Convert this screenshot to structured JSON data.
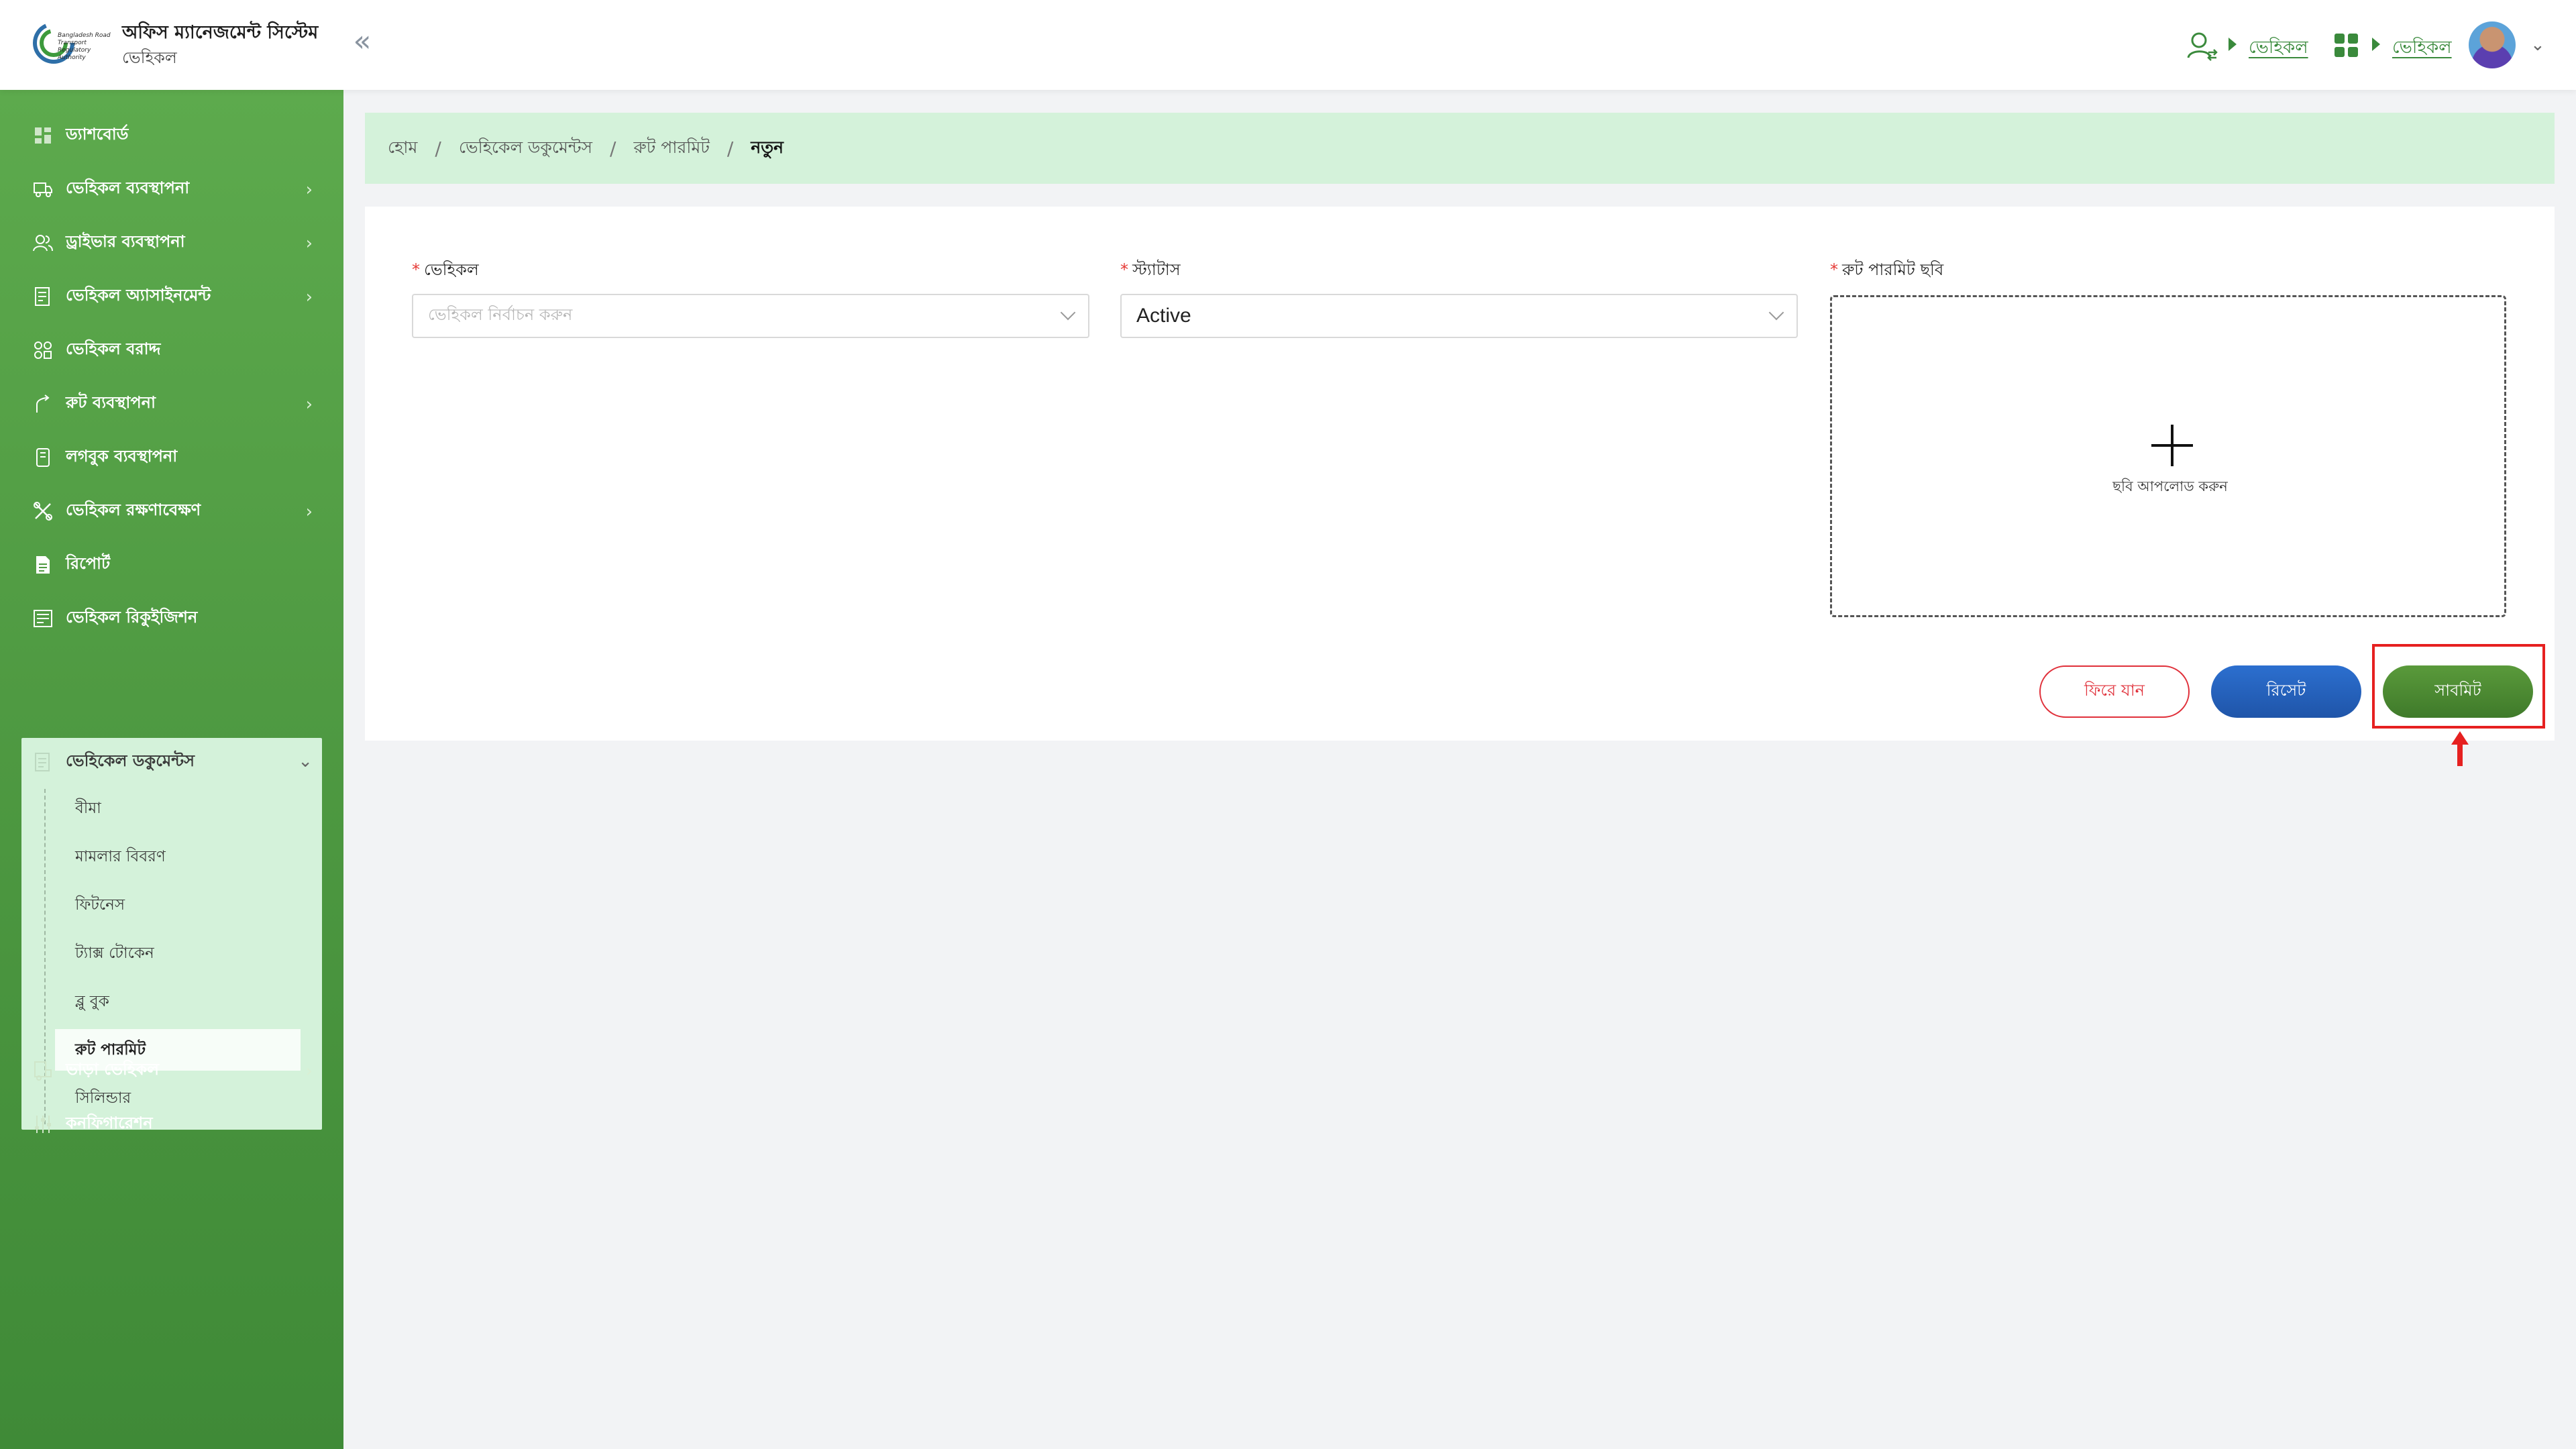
{
  "header": {
    "org_text": "Bangladesh Road Transport Regulatory Authority",
    "app_title": "অফিস ম্যানেজমেন্ট সিস্টেম",
    "app_subtitle": "ভেহিকল",
    "link1": "ভেহিকল",
    "link2": "ভেহিকল"
  },
  "sidebar": {
    "items": [
      {
        "label": "ড্যাশবোর্ড"
      },
      {
        "label": "ভেহিকল ব্যবস্থাপনা"
      },
      {
        "label": "ড্রাইভার ব্যবস্থাপনা"
      },
      {
        "label": "ভেহিকল অ্যাসাইনমেন্ট"
      },
      {
        "label": "ভেহিকল বরাদ্দ"
      },
      {
        "label": "রুট ব্যবস্থাপনা"
      },
      {
        "label": "লগবুক ব্যবস্থাপনা"
      },
      {
        "label": "ভেহিকল রক্ষণাবেক্ষণ"
      },
      {
        "label": "রিপোর্ট"
      },
      {
        "label": "ভেহিকল রিকুইজিশন"
      }
    ],
    "expanded": {
      "label": "ভেহিকেল ডকুমেন্টস",
      "children": [
        "বীমা",
        "মামলার বিবরণ",
        "ফিটনেস",
        "ট্যাক্স টোকেন",
        "ব্লু বুক",
        "রুট পারমিট",
        "সিলিন্ডার"
      ]
    },
    "bottom_items": [
      {
        "label": "ভাড়া ভেহিকল"
      },
      {
        "label": "কনফিগারেশন"
      }
    ]
  },
  "breadcrumb": [
    "হোম",
    "ভেহিকেল ডকুমেন্টস",
    "রুট পারমিট",
    "নতুন"
  ],
  "form": {
    "vehicle_label": "ভেহিকল",
    "vehicle_placeholder": "ভেহিকল নির্বাচন করুন",
    "status_label": "স্ট্যাটাস",
    "status_value": "Active",
    "image_label": "রুট পারমিট ছবি",
    "upload_text": "ছবি আপলোড করুন",
    "required_mark": "*"
  },
  "buttons": {
    "back": "ফিরে যান",
    "reset": "রিসেট",
    "submit": "সাবমিট"
  },
  "colors": {
    "sidebar_green": "#4f9a42",
    "light_green": "#d4f2da",
    "submit_green": "#4a8a33",
    "reset_blue": "#1f55a9",
    "back_red": "#e0303a",
    "highlight_red": "#e62020"
  }
}
